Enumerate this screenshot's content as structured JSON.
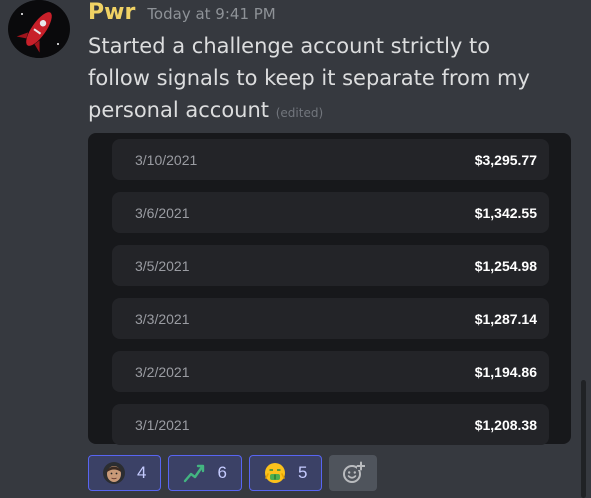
{
  "message": {
    "username": "Pwr",
    "timestamp": "Today at 9:41 PM",
    "text": "Started a challenge account strictly to follow signals to keep it separate from my personal account",
    "edited_label": "(edited)",
    "username_color": "#f0d264",
    "avatar_icon": "rocket-avatar-icon"
  },
  "embed": {
    "rows": [
      {
        "date": "3/10/2021",
        "amount": "$3,295.77"
      },
      {
        "date": "3/6/2021",
        "amount": "$1,342.55"
      },
      {
        "date": "3/5/2021",
        "amount": "$1,254.98"
      },
      {
        "date": "3/3/2021",
        "amount": "$1,287.14"
      },
      {
        "date": "3/2/2021",
        "amount": "$1,194.86"
      },
      {
        "date": "3/1/2021",
        "amount": "$1,208.38"
      }
    ]
  },
  "reactions": [
    {
      "emoji": "face-photo-emoji",
      "count": "4"
    },
    {
      "emoji": "chart-increasing-emoji",
      "count": "6"
    },
    {
      "emoji": "money-mouth-face-emoji",
      "count": "5"
    }
  ],
  "add_reaction_icon": "add-reaction-icon",
  "colors": {
    "accent": "#5865f2",
    "background": "#36393f",
    "embed_bg": "#17181b",
    "row_bg": "#232428"
  }
}
